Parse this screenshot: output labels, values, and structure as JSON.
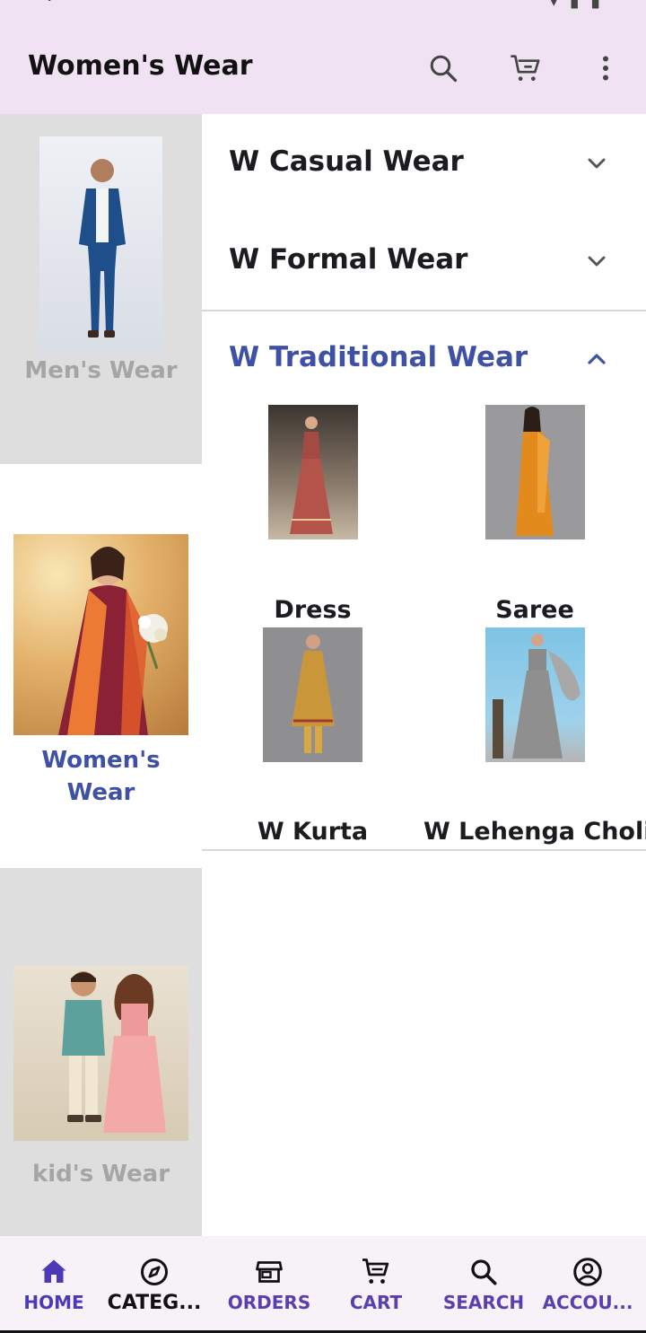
{
  "appbar": {
    "title": "Women's Wear",
    "actions": [
      "search-icon",
      "cart-icon",
      "more-vert-icon"
    ]
  },
  "categories": [
    {
      "label": "Men's Wear",
      "active": false
    },
    {
      "label": "Women's Wear",
      "active": true
    },
    {
      "label": "kid's Wear",
      "active": false
    }
  ],
  "sections": [
    {
      "title": "W Casual Wear",
      "expanded": false
    },
    {
      "title": "W Formal Wear",
      "expanded": false
    },
    {
      "title": "W Traditional Wear",
      "expanded": true
    }
  ],
  "subcategories": [
    {
      "label": "Dress"
    },
    {
      "label": "Saree"
    },
    {
      "label": "W Kurta"
    },
    {
      "label": "W Lehenga Choli"
    }
  ],
  "bottom_nav": [
    {
      "label": "HOME",
      "icon": "home-icon",
      "selected": true
    },
    {
      "label": "CATEG...",
      "icon": "compass-icon",
      "selected": false
    },
    {
      "label": "ORDERS",
      "icon": "store-icon",
      "selected": false
    },
    {
      "label": "CART",
      "icon": "cart-icon",
      "selected": false
    },
    {
      "label": "SEARCH",
      "icon": "search-icon",
      "selected": false
    },
    {
      "label": "ACCOU...",
      "icon": "account-icon",
      "selected": false
    }
  ],
  "colors": {
    "appbar_bg": "#f0e2f3",
    "accent": "#3f51a5",
    "nav_label": "#5b3fb0",
    "sidebar_bg": "#dedede"
  }
}
